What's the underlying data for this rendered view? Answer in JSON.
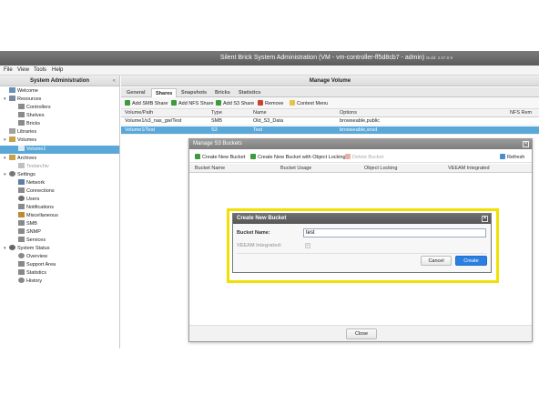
{
  "window": {
    "title": "Silent Brick System Administration (VM - vm-controller-ff5d8cb7 - admin)",
    "build": "Build: 2.57.0.9"
  },
  "menu": [
    "File",
    "View",
    "Tools",
    "Help"
  ],
  "sidebar": {
    "title": "System Administration",
    "collapse": "«",
    "items": [
      {
        "label": "Welcome",
        "icon": "home-icon"
      },
      {
        "label": "Resources",
        "icon": "grid-icon"
      },
      {
        "label": "Controllers",
        "icon": "controller-icon"
      },
      {
        "label": "Shelves",
        "icon": "shelf-icon"
      },
      {
        "label": "Bricks",
        "icon": "brick-icon"
      },
      {
        "label": "Libraries",
        "icon": "library-icon"
      },
      {
        "label": "Volumes",
        "icon": "folder-icon"
      },
      {
        "label": "Volume1",
        "icon": "volume-icon"
      },
      {
        "label": "Archives",
        "icon": "folder-icon"
      },
      {
        "label": "Testarchiv",
        "icon": "archive-icon"
      },
      {
        "label": "Settings",
        "icon": "gear-icon"
      },
      {
        "label": "Network",
        "icon": "network-icon"
      },
      {
        "label": "Connections",
        "icon": "connections-icon"
      },
      {
        "label": "Users",
        "icon": "users-icon"
      },
      {
        "label": "Notifications",
        "icon": "bell-icon"
      },
      {
        "label": "Miscellaneous",
        "icon": "misc-icon"
      },
      {
        "label": "SMB",
        "icon": "smb-icon"
      },
      {
        "label": "SNMP",
        "icon": "snmp-icon"
      },
      {
        "label": "Services",
        "icon": "services-icon"
      },
      {
        "label": "System Status",
        "icon": "status-icon"
      },
      {
        "label": "Overview",
        "icon": "overview-icon"
      },
      {
        "label": "Support Area",
        "icon": "support-icon"
      },
      {
        "label": "Statistics",
        "icon": "stats-icon"
      },
      {
        "label": "History",
        "icon": "history-icon"
      }
    ]
  },
  "main": {
    "title": "Manage Volume",
    "tabs": [
      "General",
      "Shares",
      "Snapshots",
      "Bricks",
      "Statistics"
    ],
    "toolbar": [
      "Add SMB Share",
      "Add NFS Share",
      "Add S3 Share",
      "Remove",
      "Context Menu"
    ],
    "columns": [
      "Volume/Path",
      "Type",
      "Name",
      "Options",
      "NFS Rem"
    ],
    "rows": [
      [
        "Volume1/s3_nas_gw/Test",
        "SMB",
        "Old_S3_Data",
        "browseable,public",
        ""
      ],
      [
        "Volume1/Test",
        "S3",
        "Test",
        "browseable,snsd",
        ""
      ]
    ]
  },
  "s3": {
    "title": "Manage S3 Buckets",
    "toolbar": [
      "Create New Bucket",
      "Create New Bucket with Object Locking",
      "Delete Bucket",
      "Refresh"
    ],
    "columns": [
      "Bucket Name",
      "Bucket Usage",
      "Object Locking",
      "VEEAM Integrated"
    ],
    "close": "Close"
  },
  "dialog": {
    "title": "Create New Bucket",
    "bucket_label": "Bucket Name:",
    "bucket_value": "test",
    "veeam_label": "VEEAM Integrated:",
    "veeam_check": "✓",
    "cancel": "Cancel",
    "create": "Create"
  },
  "colors": {
    "selection": "#59a8d8",
    "highlight": "#f2e000",
    "primary": "#2a7fe0"
  }
}
